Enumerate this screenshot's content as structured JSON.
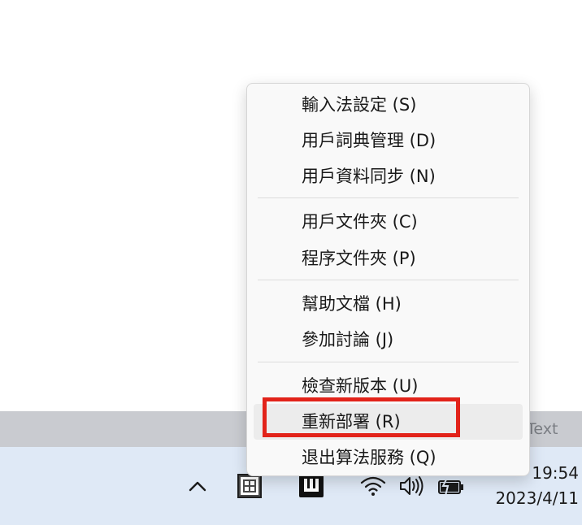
{
  "backdrop": {
    "partial_text": "Text"
  },
  "menu": {
    "items": [
      {
        "label": "輸入法設定 (S)"
      },
      {
        "label": "用戶詞典管理 (D)"
      },
      {
        "label": "用戶資料同步 (N)"
      },
      {
        "label": "用戶文件夾 (C)"
      },
      {
        "label": "程序文件夾 (P)"
      },
      {
        "label": "幫助文檔 (H)"
      },
      {
        "label": "參加討論 (J)"
      },
      {
        "label": "檢查新版本 (U)"
      },
      {
        "label": "重新部署 (R)",
        "hovered": true,
        "highlighted": true
      },
      {
        "label": "退出算法服務 (Q)"
      }
    ]
  },
  "highlight": {
    "color": "#e2231a"
  },
  "taskbar": {
    "tray_icons": [
      "chevron-up-icon",
      "ime-icon",
      "rime-icon",
      "wifi-icon",
      "volume-icon",
      "battery-icon"
    ],
    "time": "19:54",
    "date": "2023/4/11"
  }
}
